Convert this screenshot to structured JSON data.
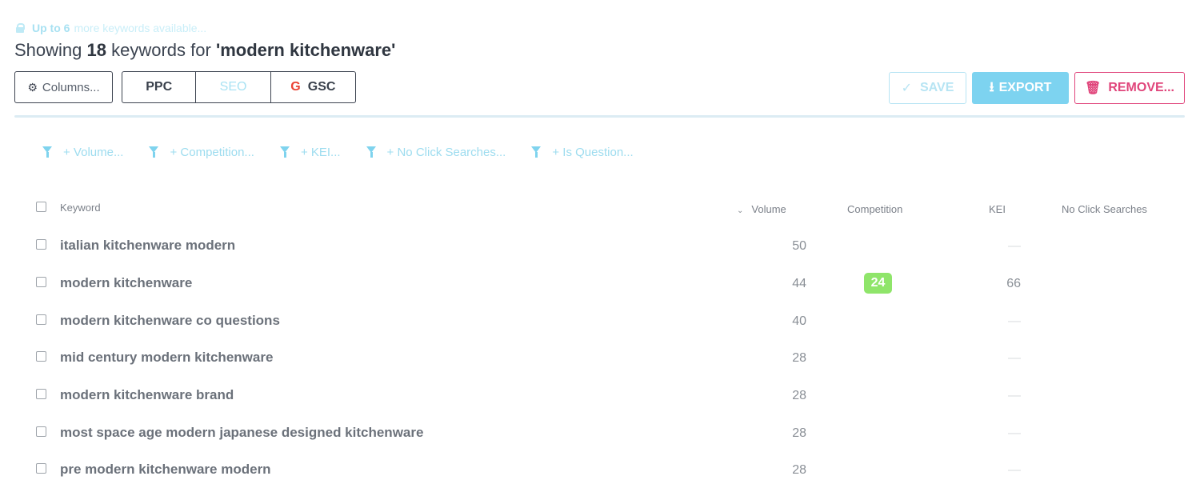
{
  "upsell": {
    "strong": "Up to 6",
    "text": "more keywords available..."
  },
  "heading": {
    "prefix": "Showing",
    "count": "18",
    "middle": "keywords for",
    "query": "'modern kitchenware'"
  },
  "toolbar": {
    "columns_label": "Columns...",
    "segments": [
      "PPC",
      "SEO",
      "GSC"
    ],
    "save_label": "SAVE",
    "export_label": "EXPORT",
    "remove_label": "REMOVE..."
  },
  "filters": [
    "+ Volume...",
    "+ Competition...",
    "+ KEI...",
    "+ No Click Searches...",
    "+ Is Question..."
  ],
  "columns": {
    "keyword": "Keyword",
    "volume": "Volume",
    "competition": "Competition",
    "kei": "KEI",
    "no_click": "No Click Searches"
  },
  "rows": [
    {
      "keyword": "italian kitchenware modern",
      "volume": "50",
      "competition": "",
      "kei": "—"
    },
    {
      "keyword": "modern kitchenware",
      "volume": "44",
      "competition": "24",
      "kei": "66"
    },
    {
      "keyword": "modern kitchenware co questions",
      "volume": "40",
      "competition": "",
      "kei": "—"
    },
    {
      "keyword": "mid century modern kitchenware",
      "volume": "28",
      "competition": "",
      "kei": "—"
    },
    {
      "keyword": "modern kitchenware brand",
      "volume": "28",
      "competition": "",
      "kei": "—"
    },
    {
      "keyword": "most space age modern japanese designed kitchenware",
      "volume": "28",
      "competition": "",
      "kei": "—"
    },
    {
      "keyword": "pre modern kitchenware modern",
      "volume": "28",
      "competition": "",
      "kei": "—"
    }
  ],
  "colors": {
    "accent": "#7dd3f0",
    "danger": "#e0457b",
    "competition_badge": "#8fe56a"
  }
}
